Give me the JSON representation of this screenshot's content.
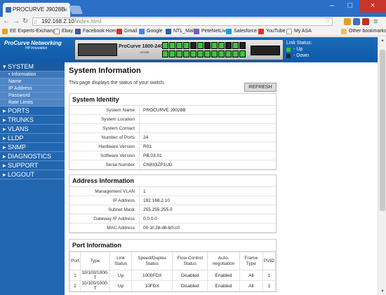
{
  "browser": {
    "tab_title": "PROCURVE J9028B",
    "url_host": "192.168.2.10",
    "url_path": "/index.html",
    "bookmarks": [
      "EE Experts-Exchange",
      "Ebay",
      "Facebook Home",
      "Gmail",
      "Google",
      "NTL_Mail",
      "PeteNetLive",
      "Salesforce",
      "YouTube",
      "My ASA"
    ],
    "other_bookmarks": "Other bookmarks"
  },
  "header": {
    "logo": "ProCurve Networking",
    "logo_sub": "HP Innovation",
    "model": "ProCurve 1800-24G",
    "serial": "J9028B",
    "link_status_title": "Link Status:",
    "link_up": "- Up",
    "link_down": "- Down",
    "colors": {
      "up": "#3ec23e",
      "down": "#222222"
    },
    "ports_top": [
      "up",
      "up",
      "up",
      "up",
      "down",
      "up",
      "down",
      "up",
      "up",
      "down",
      "up",
      "down"
    ],
    "ports_bottom": [
      "up",
      "up",
      "up",
      "up",
      "up",
      "up",
      "up",
      "up",
      "up",
      "up",
      "up",
      "up"
    ]
  },
  "sidebar": {
    "system": "SYSTEM",
    "subitems": [
      "Information",
      "Name",
      "IP Address",
      "Password",
      "Rate Limits"
    ],
    "sections": [
      "PORTS",
      "TRUNKS",
      "VLANS",
      "LLDP",
      "SNMP",
      "DIAGNOSTICS",
      "SUPPORT",
      "LOGOUT"
    ]
  },
  "main": {
    "title": "System Information",
    "description": "This page displays the status of your switch.",
    "refresh": "REFRESH",
    "identity": {
      "title": "System Identity",
      "rows": [
        {
          "k": "System Name",
          "v": "PROCURVE J9028B"
        },
        {
          "k": "System Location",
          "v": ""
        },
        {
          "k": "System Contact",
          "v": ""
        },
        {
          "k": "Number of Ports",
          "v": "24"
        },
        {
          "k": "Hardware Version",
          "v": "R01"
        },
        {
          "k": "Software Version",
          "v": "PB.03.01"
        },
        {
          "k": "Serial Number",
          "v": "CN833ZP1UD"
        }
      ]
    },
    "address": {
      "title": "Address Information",
      "rows": [
        {
          "k": "Management VLAN",
          "v": "1"
        },
        {
          "k": "IP Address",
          "v": "192.168.2.10"
        },
        {
          "k": "Subnet Mask",
          "v": "255.255.255.0"
        },
        {
          "k": "Gateway IP Address",
          "v": "0.0.0.0"
        },
        {
          "k": "MAC Address",
          "v": "00-1f-28-d6-b0-c0"
        }
      ]
    },
    "ports": {
      "title": "Port Information",
      "headers": [
        "Port",
        "Type",
        "Link Status",
        "Speed/Duplex Status",
        "Flow Control Status",
        "Auto-negotiation",
        "Frame Type",
        "PVID"
      ],
      "rows": [
        [
          "1",
          "10/100/1000-T",
          "Up",
          "1000FDX",
          "Disabled",
          "Enabled",
          "All",
          "1"
        ],
        [
          "2",
          "10/100/1000-T",
          "Up",
          "10FDX",
          "Disabled",
          "Enabled",
          "All",
          "1"
        ]
      ]
    }
  }
}
